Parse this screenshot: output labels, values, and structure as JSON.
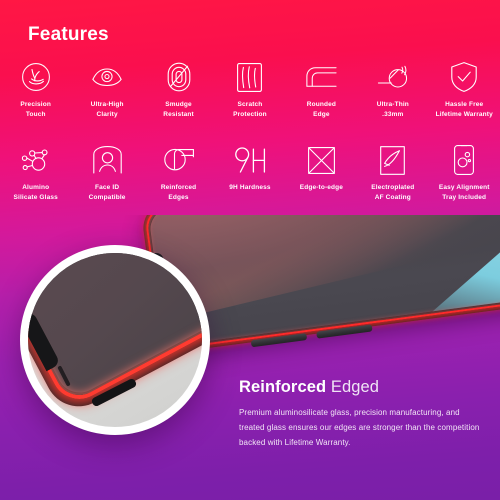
{
  "header": {
    "title": "Features"
  },
  "features": {
    "row1": [
      {
        "icon": "precision-touch-icon",
        "label": "Precision\nTouch"
      },
      {
        "icon": "eye-clarity-icon",
        "label": "Ultra-High\nClarity"
      },
      {
        "icon": "fingerprint-smudge-icon",
        "label": "Smudge\nResistant"
      },
      {
        "icon": "scratch-shield-icon",
        "label": "Scratch\nProtection"
      },
      {
        "icon": "rounded-edge-icon",
        "label": "Rounded\nEdge"
      },
      {
        "icon": "caliper-thickness-icon",
        "label": "Ultra-Thin\n.33mm"
      },
      {
        "icon": "shield-check-icon",
        "label": "Hassle Free\nLifetime Warranty"
      }
    ],
    "row2": [
      {
        "icon": "molecule-icon",
        "label": "Alumino\nSilicate Glass"
      },
      {
        "icon": "face-id-icon",
        "label": "Face ID\nCompatible"
      },
      {
        "icon": "reinforced-edges-icon",
        "label": "Reinforced\nEdges"
      },
      {
        "icon": "hardness-9h-icon",
        "label": "9H Hardness",
        "glyph": "9H"
      },
      {
        "icon": "edge-to-edge-icon",
        "label": "Edge-to-edge"
      },
      {
        "icon": "electroplated-coating-icon",
        "label": "Electroplated\nAF Coating"
      },
      {
        "icon": "alignment-tray-icon",
        "label": "Easy Alignment\nTray Included"
      }
    ]
  },
  "product_image": {
    "magnifier": "magnified-phone-corner",
    "phone": "tempered-glass-phone"
  },
  "copy": {
    "heading_bold": "Reinforced",
    "heading_light": " Edged",
    "body": "Premium aluminosilicate glass, precision manufacturing, and treated glass ensures our edges are stronger than the competition backed with Lifetime Warranty."
  },
  "colors": {
    "gradient_top": "#ff1744",
    "gradient_bottom": "#7a1fa8",
    "icon_stroke": "#ffffff",
    "glow_red": "#ff2a2a",
    "screen_teal": "#9fe3ef"
  }
}
